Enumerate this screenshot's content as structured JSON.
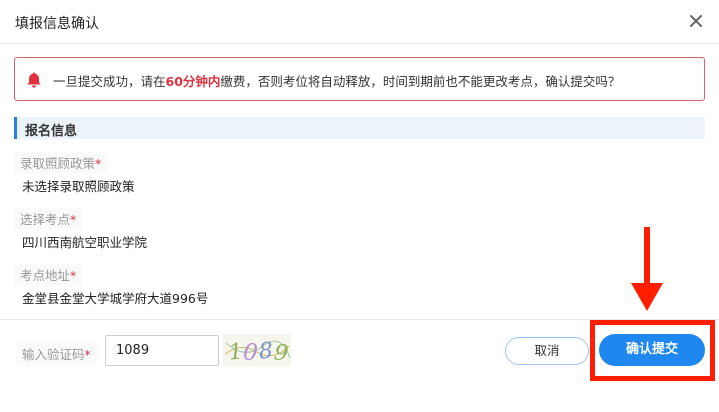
{
  "dialog": {
    "title": "填报信息确认",
    "close_icon": "close-icon"
  },
  "notice": {
    "icon": "bell-icon",
    "text_before": "一旦提交成功，请在",
    "text_highlight": "60分钟内",
    "text_after": "缴费，否则考位将自动释放，时间到期前也不能更改考点，确认提交吗？"
  },
  "section": {
    "title": "报名信息"
  },
  "fields": [
    {
      "label": "录取照顾政策",
      "required": "*",
      "value": "未选择录取照顾政策"
    },
    {
      "label": "选择考点",
      "required": "*",
      "value": "四川西南航空职业学院"
    },
    {
      "label": "考点地址",
      "required": "*",
      "value": "金堂县金堂大学城学府大道996号"
    }
  ],
  "captcha": {
    "label": "输入验证码",
    "required": "*",
    "input_value": "1089",
    "image_text": "1089"
  },
  "buttons": {
    "cancel": "取消",
    "confirm": "确认提交"
  },
  "colors": {
    "accent": "#1f87f0",
    "alert": "#e0313f",
    "annotation": "#ff1f00"
  }
}
